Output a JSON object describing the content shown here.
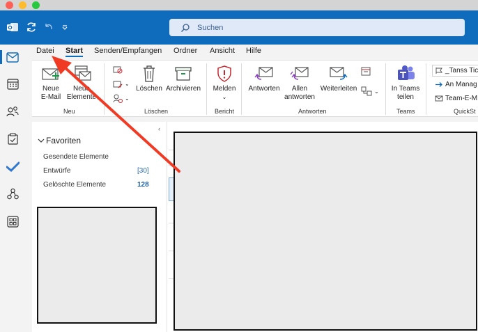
{
  "window": {
    "colors": {
      "close": "#fe5f57",
      "minimize": "#febc2e",
      "zoom": "#28c840"
    }
  },
  "toolbar": {
    "icons": [
      "outlook-app-icon",
      "sync-icon",
      "undo-icon",
      "customize-quick-access-icon"
    ],
    "search_label": "Suchen",
    "accent": "#0f6cbd"
  },
  "menu": {
    "file": "Datei",
    "tabs": [
      "Start",
      "Senden/Empfangen",
      "Ordner",
      "Ansicht",
      "Hilfe"
    ]
  },
  "ribbon": {
    "neu": {
      "new_mail_1": "Neue",
      "new_mail_2": "E-Mail",
      "new_items_1": "Neue",
      "new_items_2": "Elemente",
      "group": "Neu"
    },
    "loeschen": {
      "delete": "Löschen",
      "archive": "Archivieren",
      "group": "Löschen"
    },
    "bericht": {
      "report": "Melden",
      "group": "Bericht"
    },
    "antworten": {
      "reply": "Antworten",
      "reply_all_1": "Allen",
      "reply_all_2": "antworten",
      "forward": "Weiterleiten",
      "group": "Antworten"
    },
    "teams": {
      "share_1": "In Teams",
      "share_2": "teilen",
      "group": "Teams"
    },
    "quickstep": {
      "items": [
        "_Tanss Tick",
        "An Manag",
        "Team-E-M"
      ],
      "group": "QuickSt"
    }
  },
  "sidebar": {
    "icons": [
      "mail-icon",
      "calendar-icon",
      "people-icon",
      "tasks-icon",
      "todo-icon",
      "org-icon",
      "apps-icon"
    ]
  },
  "folders": {
    "favorites_label": "Favoriten",
    "items": [
      {
        "name": "Gesendete Elemente",
        "count": ""
      },
      {
        "name": "Entwürfe",
        "count": "[30]"
      },
      {
        "name": "Gelöschte Elemente",
        "count": "128"
      }
    ]
  },
  "annotation": {
    "arrow_color": "#f03a24"
  }
}
